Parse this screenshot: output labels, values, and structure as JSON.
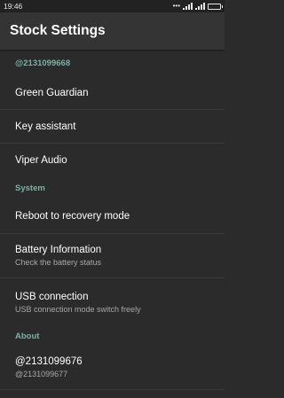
{
  "status_bar": {
    "time": "19:46",
    "icons": [
      "more-dots-icon",
      "signal-icon",
      "signal-icon",
      "battery-icon"
    ]
  },
  "app_bar": {
    "title": "Stock Settings"
  },
  "sections": {
    "top": {
      "header": "@2131099668",
      "items": [
        {
          "title": "Green Guardian"
        },
        {
          "title": "Key assistant"
        },
        {
          "title": "Viper Audio"
        }
      ]
    },
    "system": {
      "header": "System",
      "items": [
        {
          "title": "Reboot to recovery mode"
        },
        {
          "title": "Battery Information",
          "subtitle": "Check the battery status"
        },
        {
          "title": "USB connection",
          "subtitle": "USB connection mode switch freely"
        }
      ]
    },
    "about": {
      "header": "About",
      "items": [
        {
          "title": "@2131099676",
          "subtitle": "@2131099677"
        }
      ]
    }
  },
  "colors": {
    "background": "#2b2b2b",
    "app_bar": "#343434",
    "section_header": "#7fb0a5",
    "subtitle": "#a8a8a8"
  }
}
